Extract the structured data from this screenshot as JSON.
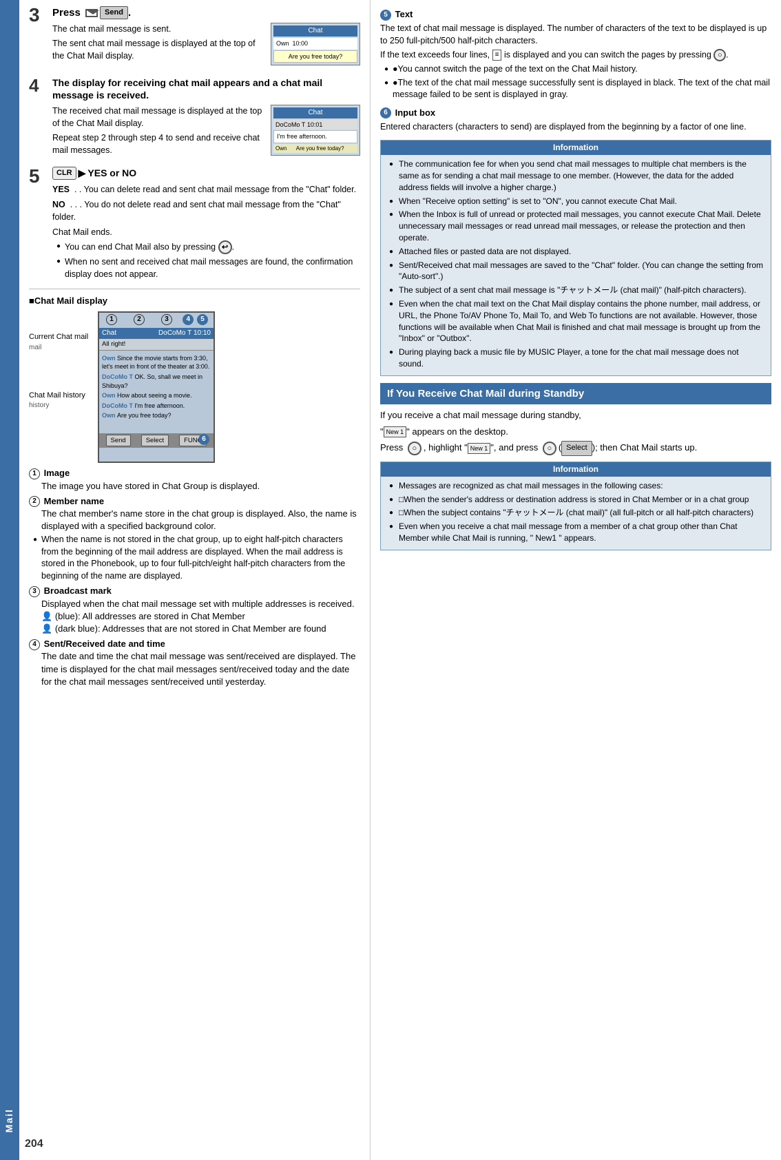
{
  "page": {
    "number": "204",
    "sidebar_label": "Mail"
  },
  "left_column": {
    "step3": {
      "number": "3",
      "title_parts": [
        "Press",
        "Send",
        "."
      ],
      "body": [
        "The chat mail message is sent.",
        "The sent chat mail message is displayed at the top of the Chat Mail display."
      ]
    },
    "step4": {
      "number": "4",
      "title": "The display for receiving chat mail appears and a chat mail message is received.",
      "body": [
        "The received chat mail message is displayed at the top of the Chat Mail display.",
        "Repeat step 2 through step 4 to send and receive chat mail messages."
      ]
    },
    "step5": {
      "number": "5",
      "title_parts": [
        "CLR",
        "YES or NO"
      ],
      "yes_text": "YES  . . You can delete read and sent chat mail message from the \"Chat\" folder.",
      "no_text": "NO  . . . You do not delete read and sent chat mail message from the \"Chat\" folder.",
      "body_after": [
        "Chat Mail ends.",
        "●You can end Chat Mail also by pressing",
        "●When no sent and received chat mail messages are found, the confirmation display does not appear."
      ]
    },
    "chat_mail_display": {
      "heading": "■Chat Mail display",
      "items": [
        {
          "num": "❶",
          "title": "Image",
          "body": "The image you have stored in Chat Group is displayed."
        },
        {
          "num": "❷",
          "title": "Member name",
          "body": "The chat member's name store in the chat group is displayed. Also, the name is displayed with a specified background color."
        },
        {
          "num_label": "●",
          "body2": "When the name is not stored in the chat group, up to eight half-pitch characters from the beginning of the mail address are displayed. When the mail address is stored in the Phonebook, up to four full-pitch/eight half-pitch characters from the beginning of the name are displayed."
        },
        {
          "num": "❸",
          "title": "Broadcast mark",
          "body": "Displayed when the chat mail message set with multiple addresses is received.",
          "blue_text": "(blue): All addresses are stored in Chat Member",
          "dark_text": "(dark blue): Addresses that are not stored in Chat Member are found"
        },
        {
          "num": "❹",
          "title": "Sent/Received date and time",
          "body": "The date and time the chat mail message was sent/received are displayed. The time is displayed for the chat mail messages sent/received today and the date for the chat mail messages sent/received until yesterday."
        }
      ],
      "labels": {
        "current_chat": "Current Chat mail",
        "chat_history": "Chat Mail history"
      }
    }
  },
  "right_column": {
    "text_section": {
      "num": "❺",
      "title": "Text",
      "body": [
        "The text of chat mail message is displayed. The number of characters of the text to be displayed is up to 250 full-pitch/500 half-pitch characters.",
        "If the text exceeds four lines,",
        "is displayed and you can switch the pages by pressing",
        "●You cannot switch the page of the text on the Chat Mail history.",
        "●The text of the chat mail message successfully sent is displayed in black. The text of the chat mail message failed to be sent is displayed in gray."
      ]
    },
    "input_box_section": {
      "num": "❻",
      "title": "Input box",
      "body": "Entered characters (characters to send) are displayed from the beginning by a factor of one line."
    },
    "information_box": {
      "title": "Information",
      "items": [
        "The communication fee for when you send chat mail messages to multiple chat members is the same as for sending a chat mail message to one member. (However, the data for the added address fields will involve a higher charge.)",
        "When \"Receive option setting\" is set to \"ON\", you cannot execute Chat Mail.",
        "When the Inbox is full of unread or protected mail messages, you cannot execute Chat Mail. Delete unnecessary mail messages or read unread mail messages, or release the protection and then operate.",
        "Attached files or pasted data are not displayed.",
        "Sent/Received chat mail messages are saved to the \"Chat\" folder. (You can change the setting from \"Auto-sort\".)",
        "The subject of a sent chat mail message is \"チャットメール (chat mail)\" (half-pitch characters).",
        "Even when the chat mail text on the Chat Mail display contains the phone number, mail address, or URL, the Phone To/AV Phone To, Mail To, and Web To functions are not available. However, those functions will be available when Chat Mail is finished and chat mail message is brought up from the \"Inbox\" or \"Outbox\".",
        "During playing back a music file by MUSIC Player, a tone for the chat mail message does not sound."
      ]
    },
    "standby_section": {
      "heading": "If You Receive Chat Mail during Standby",
      "body_lines": [
        "If you receive a chat mail message during standby,",
        "\" New1 \" appears on the desktop.",
        "Press",
        ", highlight \" New1 \", and press",
        "( Select );",
        "then Chat Mail starts up."
      ],
      "information_box2": {
        "title": "Information",
        "items": [
          "Messages are recognized as chat mail messages in the following cases:",
          "When the sender's address or destination address is stored in Chat Member or in a chat group",
          "When the subject contains \"チャットメール (chat mail)\" (all full-pitch or all half-pitch characters)",
          "Even when you receive a chat mail message from a member of a chat group other than Chat Member while Chat Mail is running, \" New1 \" appears."
        ]
      }
    }
  }
}
